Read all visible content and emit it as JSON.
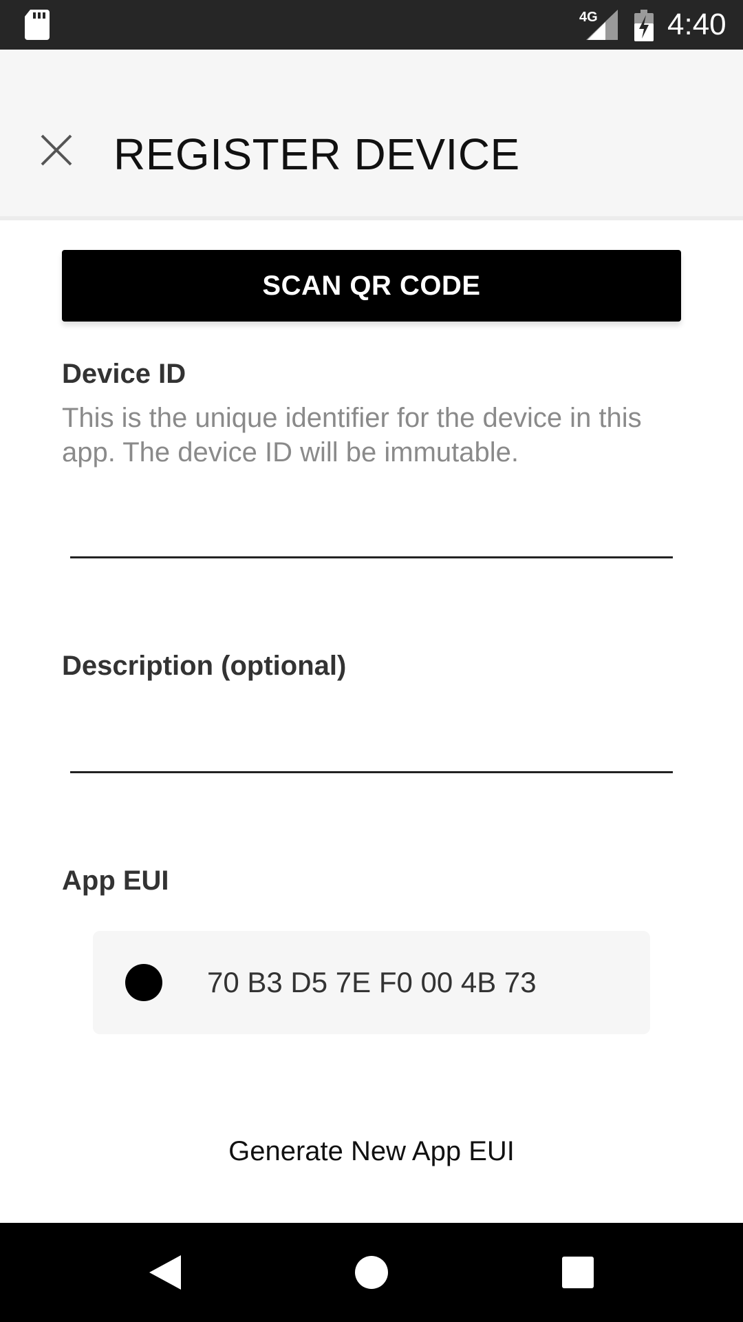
{
  "status_bar": {
    "time": "4:40",
    "network": "4G",
    "icons": [
      "sd-card-icon",
      "signal-icon",
      "battery-charging-icon"
    ]
  },
  "header": {
    "title": "REGISTER DEVICE",
    "close_icon": "close-icon"
  },
  "scan_button": {
    "label": "SCAN QR CODE"
  },
  "device_id": {
    "label": "Device ID",
    "help": "This is the unique identifier for the device in this app. The device ID will be immutable.",
    "value": ""
  },
  "description": {
    "label": "Description (optional)",
    "value": ""
  },
  "app_eui": {
    "label": "App EUI",
    "value": "70 B3 D5 7E F0 00 4B 73",
    "selected": true
  },
  "generate_link": {
    "label": "Generate New App EUI"
  },
  "nav_bar": {
    "buttons": [
      "back-icon",
      "home-icon",
      "recents-icon"
    ]
  },
  "colors": {
    "status_bar_bg": "#262626",
    "app_bar_bg": "#f6f6f6",
    "button_bg": "#000000",
    "button_text": "#ffffff",
    "help_text": "#8a8a8a",
    "eui_box_bg": "#f6f6f6"
  }
}
